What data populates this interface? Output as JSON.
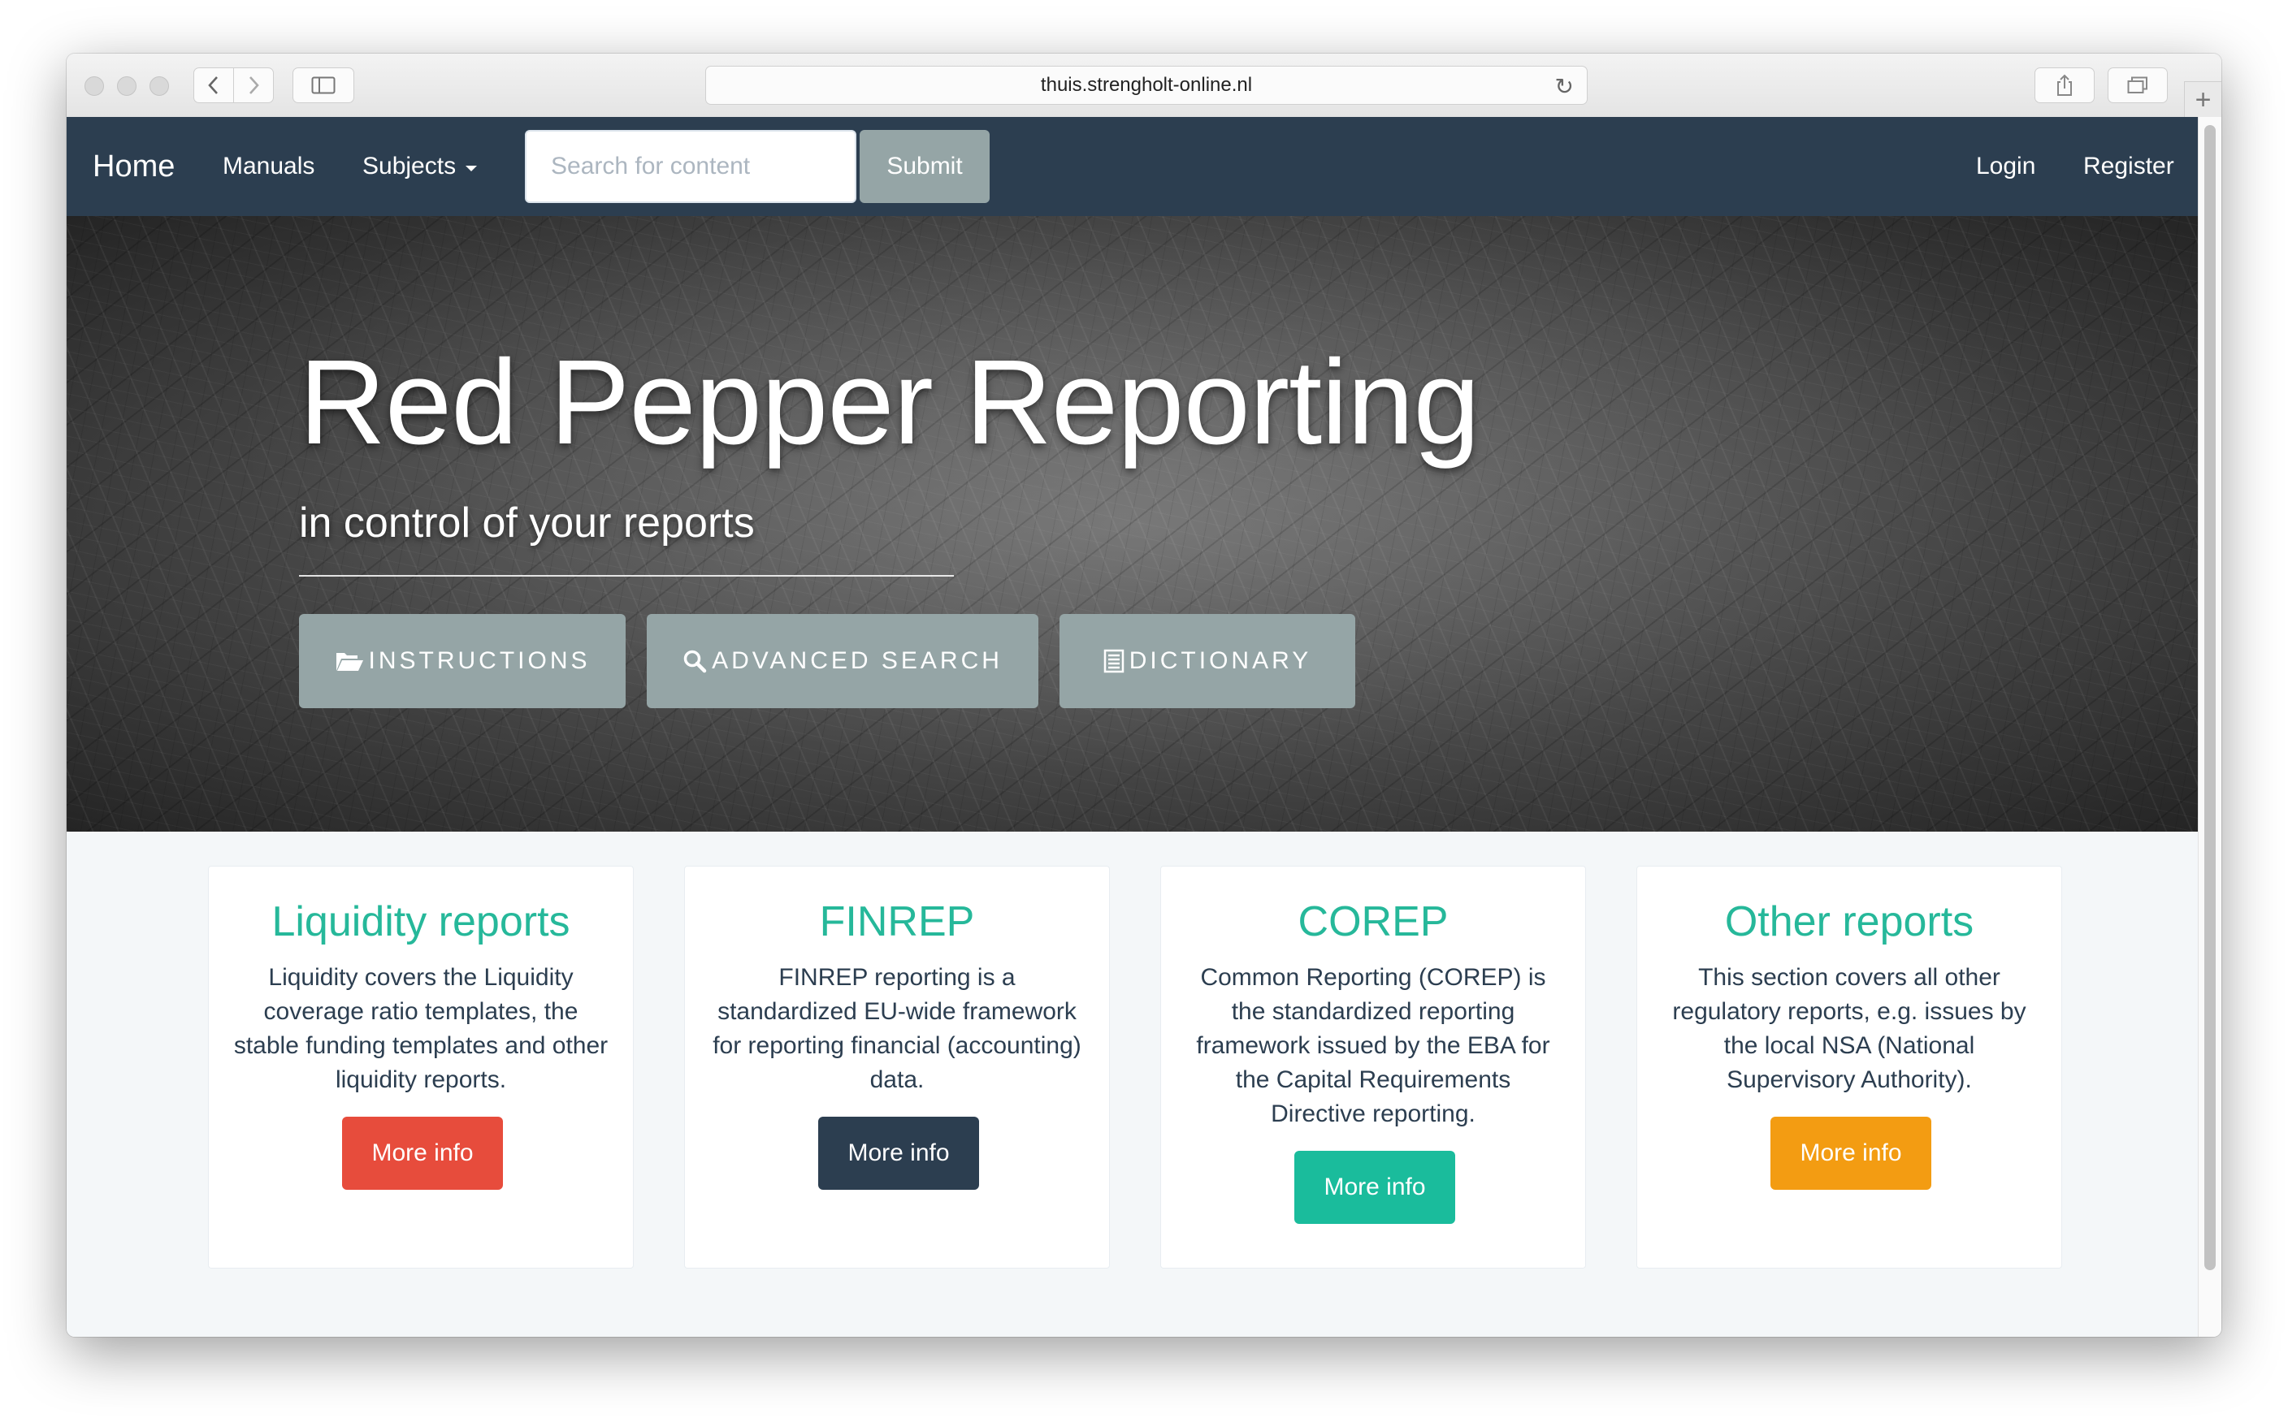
{
  "browser": {
    "url": "thuis.strengholt-online.nl",
    "new_tab_symbol": "+"
  },
  "navbar": {
    "brand": "Home",
    "manuals": "Manuals",
    "subjects": "Subjects",
    "search_placeholder": "Search for content",
    "submit": "Submit",
    "login": "Login",
    "register": "Register",
    "background_color": "#2c3e50"
  },
  "hero": {
    "title": "Red Pepper Reporting",
    "subtitle": "in control of your reports",
    "buttons": [
      {
        "label": "INSTRUCTIONS",
        "icon": "folder-open-icon"
      },
      {
        "label": "ADVANCED SEARCH",
        "icon": "search-icon"
      },
      {
        "label": "DICTIONARY",
        "icon": "list-icon"
      }
    ],
    "button_color": "#95a5a6"
  },
  "cards": [
    {
      "title": "Liquidity reports",
      "text": "Liquidity covers the Liquidity coverage ratio templates, the stable funding templates and other liquidity reports.",
      "button": "More info",
      "button_color": "#e74c3c"
    },
    {
      "title": "FINREP",
      "text": "FINREP reporting is a standardized EU-wide framework for reporting financial (accounting) data.",
      "button": "More info",
      "button_color": "#2c3e50"
    },
    {
      "title": "COREP",
      "text": "Common Reporting (COREP) is the standardized reporting framework issued by the EBA for the Capital Requirements Directive reporting.",
      "button": "More info",
      "button_color": "#1abc9c"
    },
    {
      "title": "Other reports",
      "text": "This section covers all other regulatory reports, e.g. issues by the local NSA (National Supervisory Authority).",
      "button": "More info",
      "button_color": "#f39c12"
    }
  ],
  "colors": {
    "card_title": "#26b89a",
    "body_text": "#2c3e50",
    "page_background": "#f4f7f9"
  }
}
